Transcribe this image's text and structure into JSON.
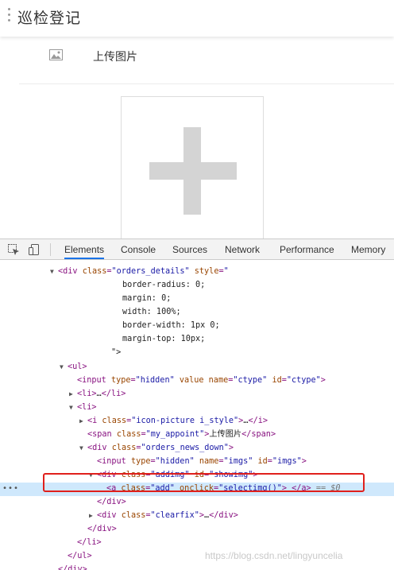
{
  "page": {
    "title": "巡检登记",
    "upload_label": "上传图片"
  },
  "devtools": {
    "tabs": [
      "Elements",
      "Console",
      "Sources",
      "Network",
      "Performance",
      "Memory"
    ],
    "active_tab": "Elements"
  },
  "dom_lines": [
    {
      "text": "<div class=\"orders_details\" style=\""
    },
    {
      "text": "border-radius: 0;"
    },
    {
      "text": "margin: 0;"
    },
    {
      "text": "width: 100%;"
    },
    {
      "text": "border-width: 1px 0;"
    },
    {
      "text": "margin-top: 10px;"
    },
    {
      "text": "\">"
    },
    {
      "text": "<ul>"
    },
    {
      "text": "<input type=\"hidden\" value name=\"ctype\" id=\"ctype\">"
    },
    {
      "text": "<li>…</li>"
    },
    {
      "text": "<li>"
    },
    {
      "text": "<i class=\"icon-picture i_style\">…</i>"
    },
    {
      "text": "<span class=\"my_appoint\">上传图片</span>"
    },
    {
      "text": "<div class=\"orders_news_down\">"
    },
    {
      "text": "<input type=\"hidden\" name=\"imgs\" id=\"imgs\">"
    },
    {
      "text": "<div class=\"addimg\" id=\"showimg\">"
    },
    {
      "text": "<a class=\"add\" onclick=\"selectimg()\"> </a>"
    },
    {
      "text": "</div>"
    },
    {
      "text": "<div class=\"clearfix\">…</div>"
    },
    {
      "text": "</div>"
    },
    {
      "text": "</li>"
    },
    {
      "text": "</ul>"
    },
    {
      "text": "</div>"
    }
  ],
  "selected_suffix": "== $0",
  "watermark": "https://blog.csdn.net/lingyuncelia"
}
